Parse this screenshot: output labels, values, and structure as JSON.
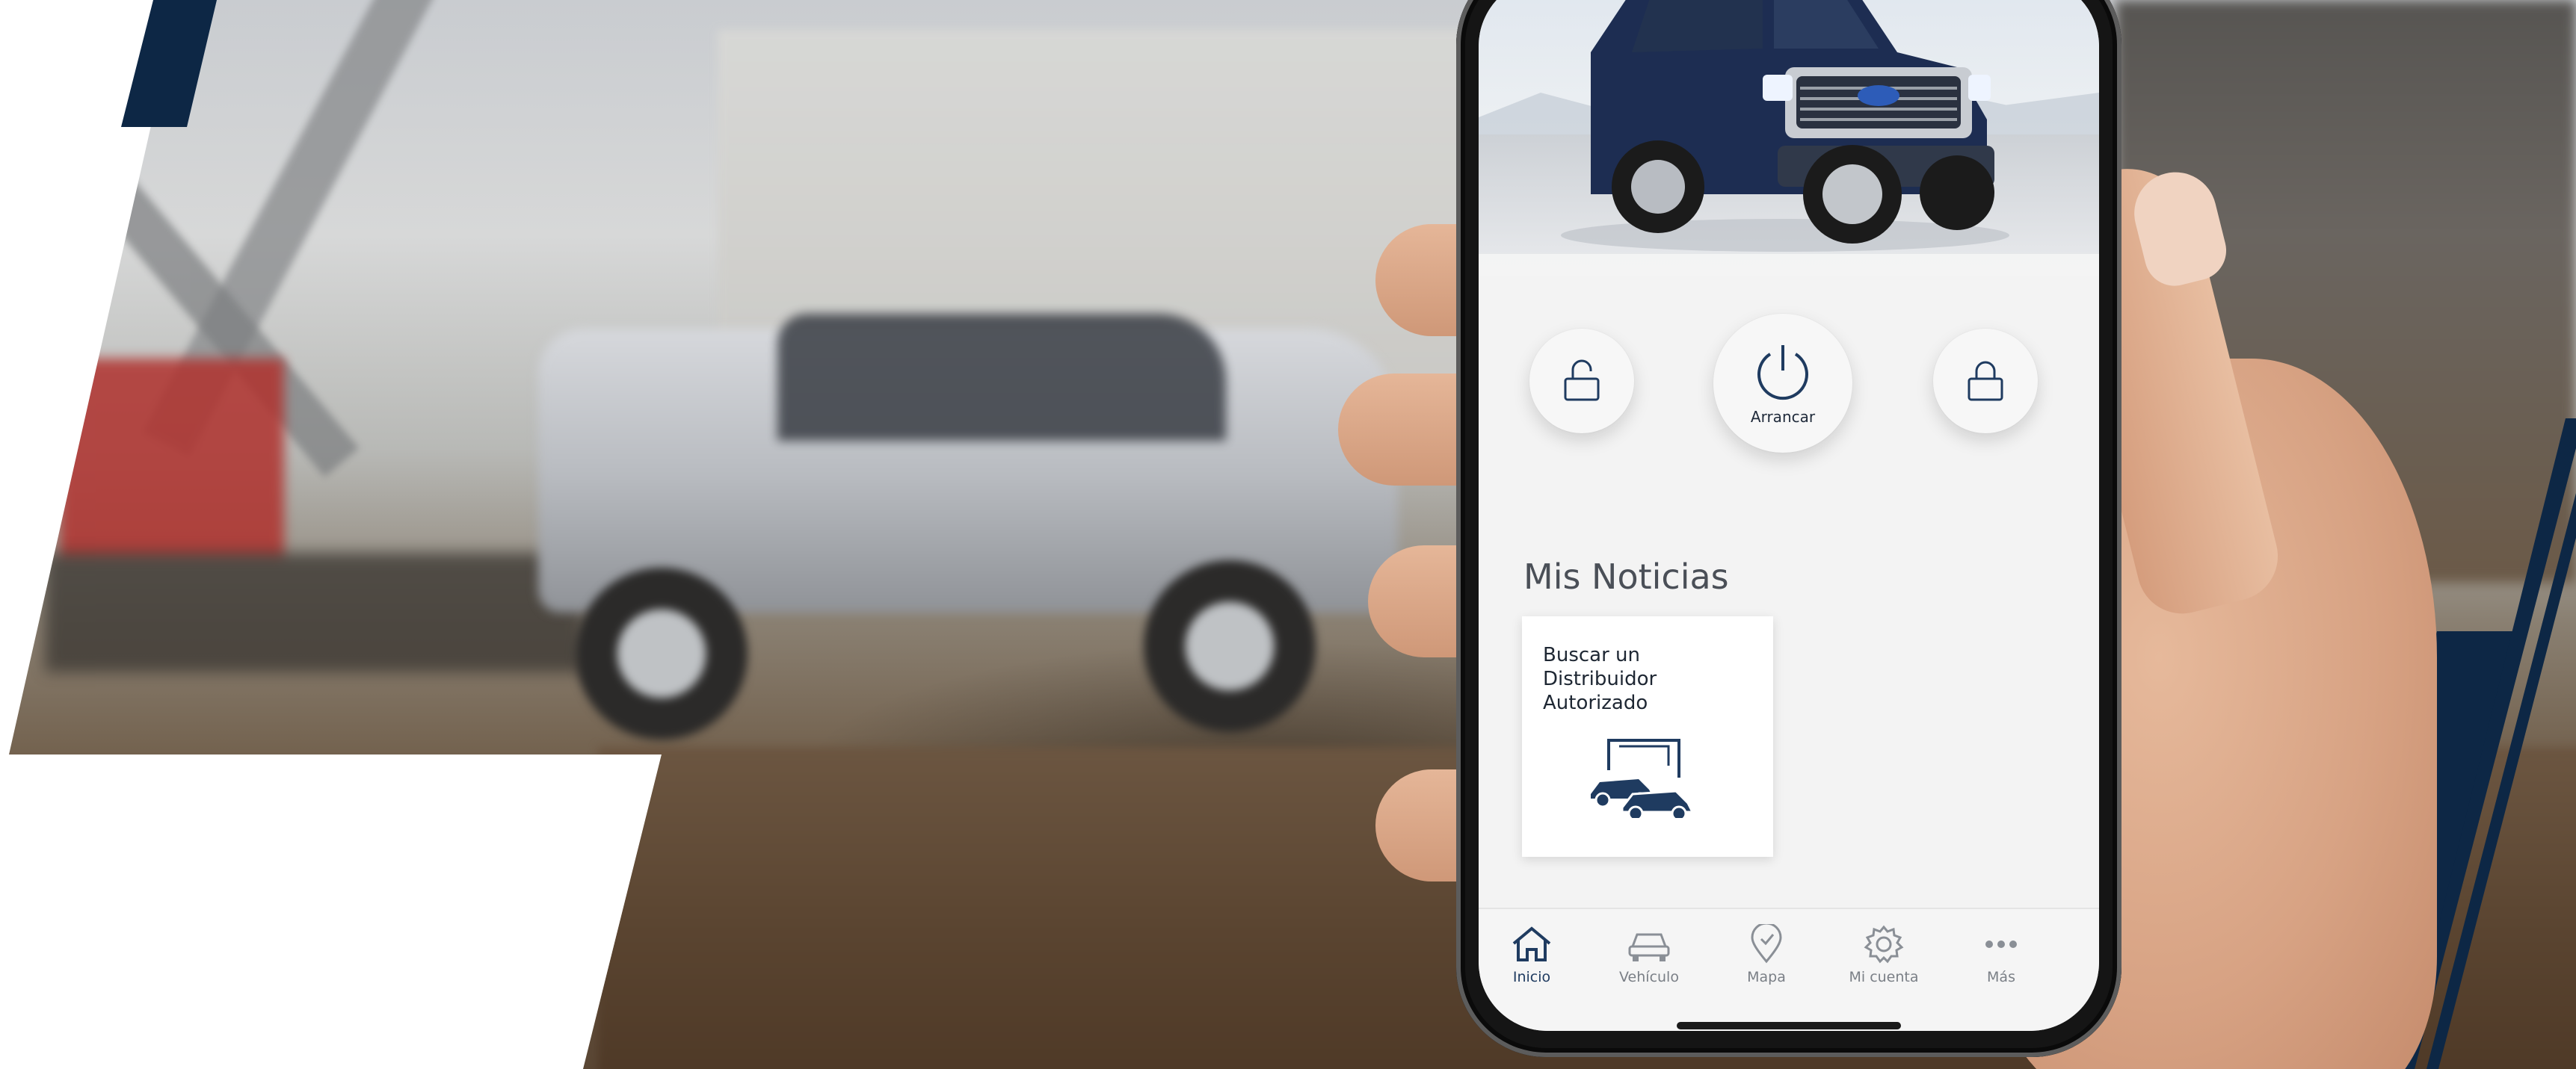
{
  "app": {
    "controls": {
      "unlock_icon": "unlock-icon",
      "start_label": "Arrancar",
      "lock_icon": "lock-icon"
    },
    "news": {
      "title": "Mis Noticias",
      "card_text": "Buscar un Distribuidor Autorizado"
    },
    "tabs": [
      {
        "label": "Inicio",
        "icon": "home-icon",
        "active": true
      },
      {
        "label": "Vehículo",
        "icon": "vehicle-icon",
        "active": false
      },
      {
        "label": "Mapa",
        "icon": "map-pin-icon",
        "active": false
      },
      {
        "label": "Mi cuenta",
        "icon": "gear-icon",
        "active": false
      },
      {
        "label": "Más",
        "icon": "more-icon",
        "active": false
      }
    ]
  },
  "colors": {
    "navy": "#0d2745",
    "accent": "#1f3b60",
    "screen_bg": "#f3f3f3"
  }
}
